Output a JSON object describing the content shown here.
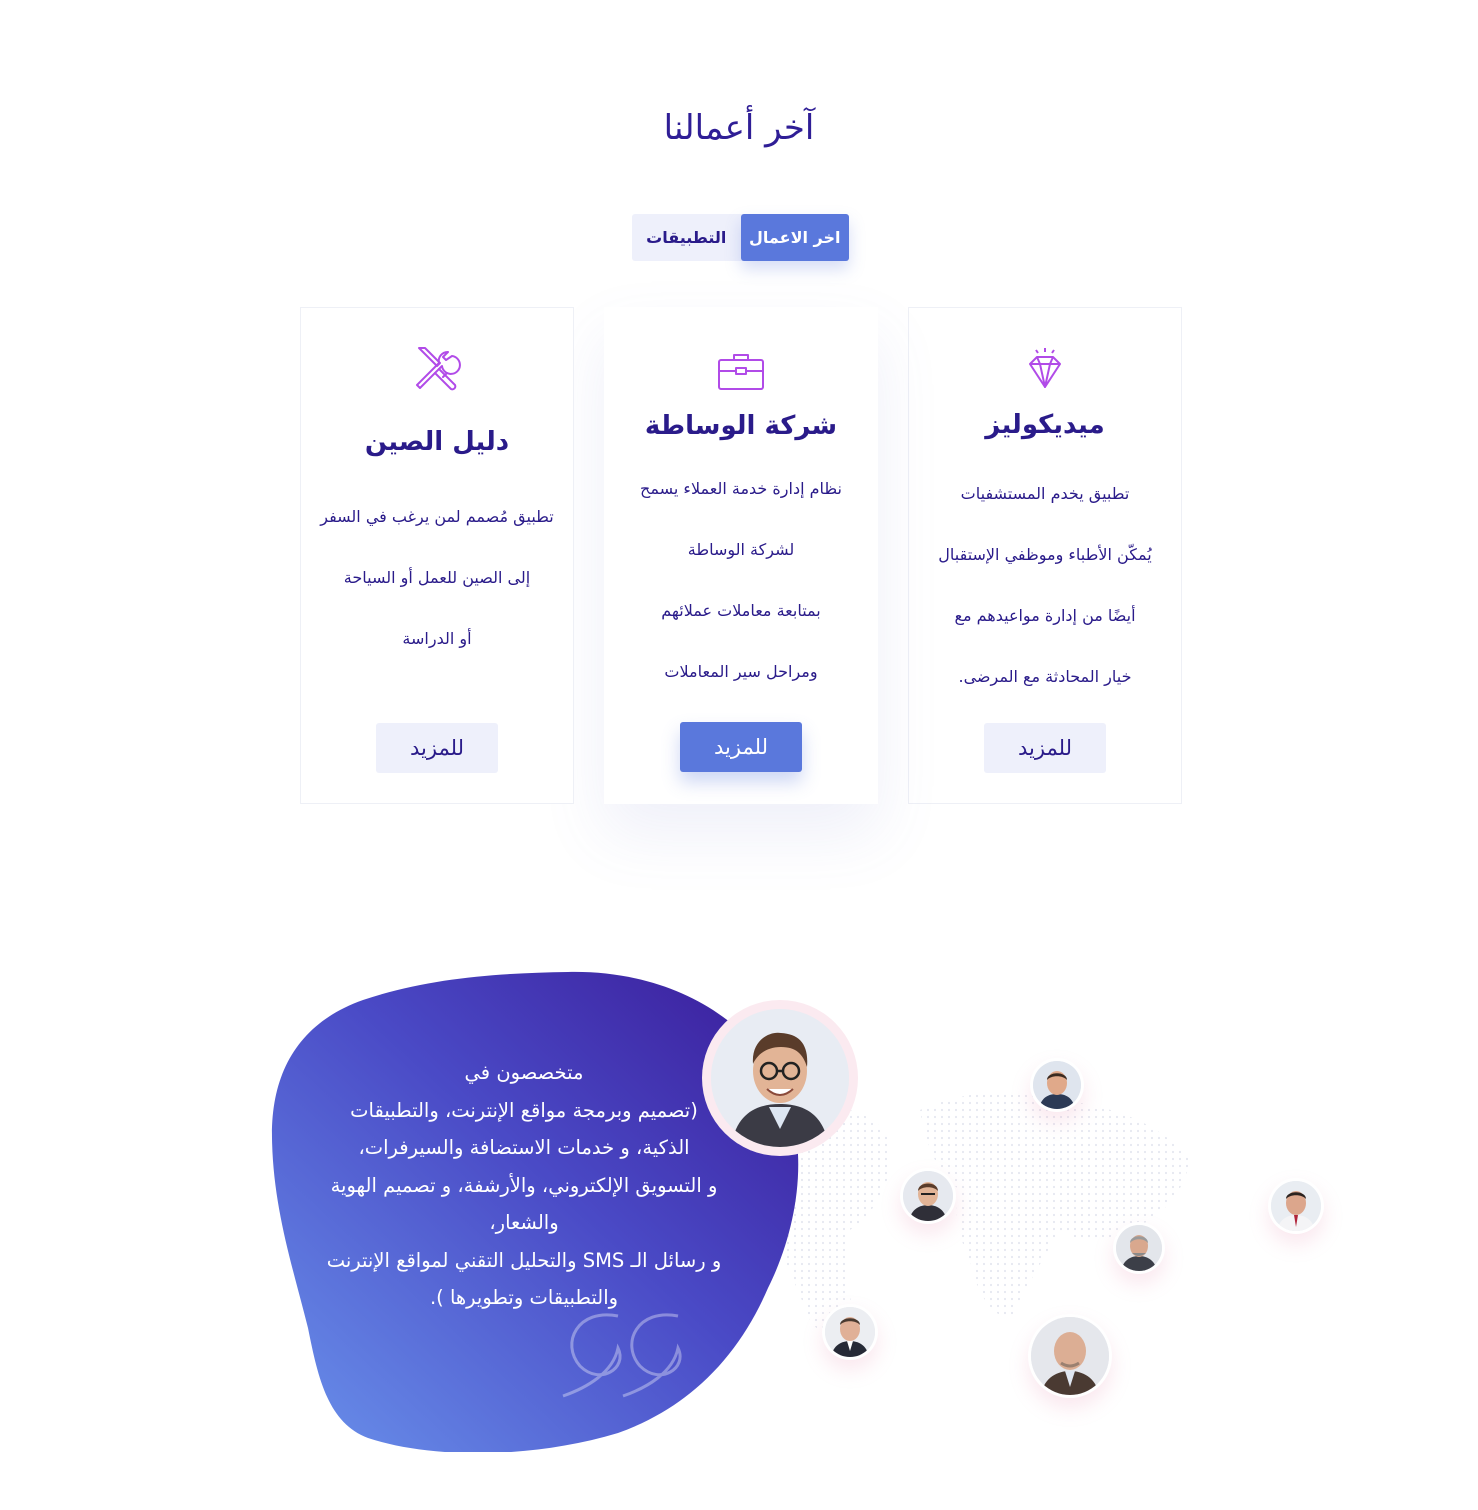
{
  "section": {
    "title": "آخر أعمالنا"
  },
  "tabs": [
    {
      "label": "التطبيقات",
      "active": false
    },
    {
      "label": "اخر الاعمال",
      "active": true
    }
  ],
  "cards": [
    {
      "title": "ميديكوليز",
      "icon": "diamond-icon",
      "lines": [
        "تطبيق يخدم المستشفيات",
        "يُمكّن الأطباء وموظفي الإستقبال",
        "أيضًا من إدارة مواعيدهم مع",
        "خيار المحادثة مع المرضى."
      ],
      "button": "للمزيد"
    },
    {
      "title": "شركة الوساطة",
      "icon": "briefcase-icon",
      "lines": [
        "نظام إدارة خدمة العملاء يسمح",
        "لشركة الوساطة",
        "بمتابعة معاملات عملائهم",
        "ومراحل سير المعاملات"
      ],
      "button": "للمزيد"
    },
    {
      "title": "دليل الصين",
      "icon": "tools-icon",
      "lines": [
        "تطبيق مُصمم لمن يرغب في السفر",
        "إلى الصين للعمل أو السياحة",
        "أو الدراسة"
      ],
      "button": "للمزيد"
    }
  ],
  "about": {
    "lines": [
      "متخصصون في",
      "(تصميم وبرمجة مواقع الإنترنت، والتطبيقات",
      "الذكية، و خدمات الاستضافة والسيرفرات،",
      "و التسويق الإلكتروني، والأرشفة، و تصميم الهوية",
      "والشعار،",
      "و رسائل الـ SMS والتحليل التقني لمواقع الإنترنت",
      "والتطبيقات وتطويرها )."
    ]
  },
  "colors": {
    "primary": "#5a78dc",
    "title": "#2a1b8a",
    "icon": "#b14be8",
    "blob_start": "#6a93ec",
    "blob_end": "#3a1a98",
    "tab_bg": "#eef0fb"
  }
}
